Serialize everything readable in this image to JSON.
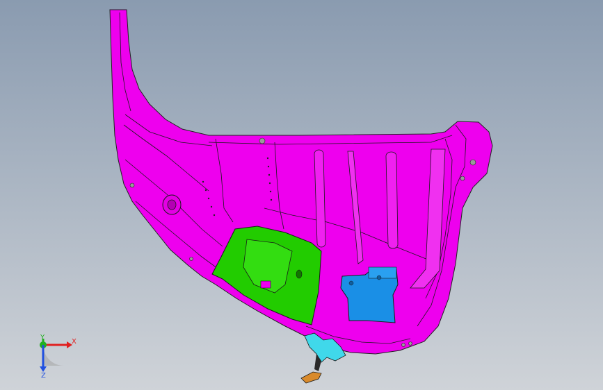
{
  "viewport": {
    "background_top": "#8a9bb0",
    "background_bottom": "#cfd3d8"
  },
  "parts": {
    "inner_panel": {
      "color": "#ee00ee",
      "icon": "part-body"
    },
    "green_bracket": {
      "color": "#22cc00",
      "icon": "part-body"
    },
    "blue_bracket": {
      "color": "#1a8fe6",
      "icon": "part-body"
    },
    "cyan_bracket": {
      "color": "#40d8ea",
      "icon": "part-body"
    },
    "orange_clip": {
      "color": "#d98a2b",
      "icon": "part-body"
    }
  },
  "triad": {
    "x_label": "X",
    "y_label": "Y",
    "z_label": "Z",
    "x_color": "#e02020",
    "y_color": "#20b020",
    "z_color": "#2050e0"
  }
}
